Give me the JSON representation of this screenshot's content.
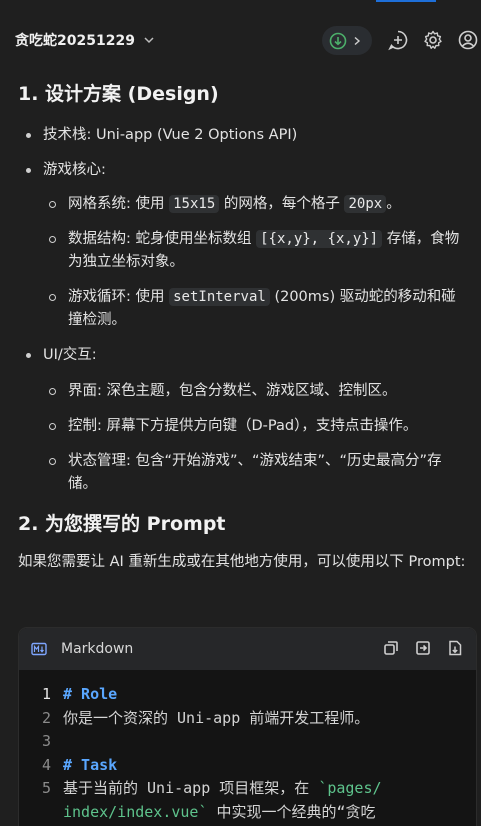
{
  "header": {
    "title": "贪吃蛇20251229",
    "icons": [
      "chevron-down-icon",
      "download-icon",
      "chevron-right-icon",
      "new-chat-icon",
      "gear-icon",
      "account-icon"
    ]
  },
  "section1": {
    "heading": "1. 设计方案 (Design)",
    "tech_stack": "技术栈: Uni-app (Vue 2 Options API)",
    "core_label": "游戏核心:",
    "grid_pre": "网格系统: 使用",
    "grid_code": "15x15",
    "grid_mid": "的网格，每个格子",
    "grid_code2": "20px",
    "grid_end": "。",
    "data_pre": "数据结构: 蛇身使用坐标数组",
    "data_code": "[{x,y}, {x,y}]",
    "data_end": "存储，食物为独立坐标对象。",
    "loop_pre": "游戏循环: 使用",
    "loop_code": "setInterval",
    "loop_end": "(200ms) 驱动蛇的移动和碰撞检测。",
    "ui_label": "UI/交互:",
    "ui_layout": "界面: 深色主题，包含分数栏、游戏区域、控制区。",
    "ui_control": "控制: 屏幕下方提供方向键（D-Pad），支持点击操作。",
    "ui_state": "状态管理: 包含“开始游戏”、“游戏结束”、“历史最高分”存储。"
  },
  "section2": {
    "heading": "2. 为您撰写的 Prompt",
    "intro": "如果您需要让 AI 重新生成或在其他地方使用，可以使用以下 Prompt:"
  },
  "codeblock": {
    "language": "Markdown",
    "lines": {
      "n1": "1",
      "n2": "2",
      "n3": "3",
      "n4": "4",
      "n5": "5",
      "l1": "# Role",
      "l2": "你是一个资深的 Uni-app 前端开发工程师。",
      "l4": "# Task",
      "l5_pre": "基于当前的 Uni-app 项目框架，在 ",
      "l5_code": "`pages/",
      "l6_code": "index/index.vue`",
      "l6_rest": " 中实现一个经典的“贪吃"
    }
  },
  "colors": {
    "background": "#1f1f1f",
    "code_background": "#141414",
    "heading_markdown": "#5aa7ff",
    "string_markdown": "#5ec38c",
    "accent": "#1e6fd9"
  }
}
